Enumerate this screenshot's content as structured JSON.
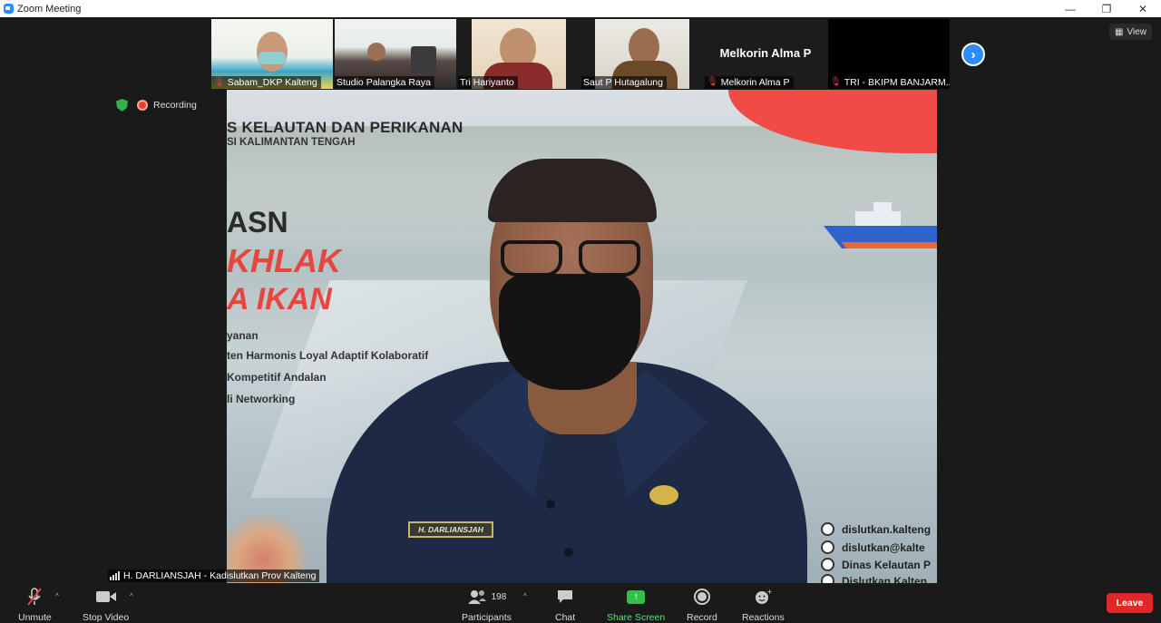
{
  "window": {
    "title": "Zoom Meeting",
    "controls": {
      "minimize": "—",
      "restore": "❐",
      "close": "✕"
    }
  },
  "view_button": {
    "label": "View"
  },
  "recording": {
    "label": "Recording"
  },
  "participants_strip": [
    {
      "name": "Sabam_DKP Kalteng",
      "muted": true
    },
    {
      "name": "Studio Palangka Raya",
      "muted": false
    },
    {
      "name": "Tri Hariyanto",
      "muted": false
    },
    {
      "name": "Saut P Hutagalung",
      "muted": false
    },
    {
      "name": "Melkorin Alma P",
      "muted": true,
      "display_text": "Melkorin Alma P"
    },
    {
      "name": "TRI - BKIPM BANJARM...",
      "muted": true
    }
  ],
  "slide": {
    "heading": "S KELAUTAN DAN PERIKANAN",
    "subheading": "SI KALIMANTAN TENGAH",
    "asn": "ASN",
    "akhlak": "KHLAK",
    "ikan": "A IKAN",
    "lines": [
      {
        "text": "yanan"
      },
      {
        "text": "ten Harmonis Loyal Adaptif Kolaboratif"
      },
      {
        "text": "Kompetitif Andalan"
      },
      {
        "text": "li Networking"
      }
    ],
    "contacts": [
      {
        "text": "dislutkan.kalteng"
      },
      {
        "text": "dislutkan@kalte"
      },
      {
        "text": "Dinas Kelautan P"
      },
      {
        "text": "Dislutkan Kalten"
      }
    ],
    "nametag": "H. DARLIANSJAH"
  },
  "active_speaker": {
    "label": "H. DARLIANSJAH - Kadislutkan Prov Kalteng"
  },
  "toolbar": {
    "unmute": "Unmute",
    "stop_video": "Stop Video",
    "participants": "Participants",
    "participants_count": "198",
    "chat": "Chat",
    "share_screen": "Share Screen",
    "record": "Record",
    "reactions": "Reactions",
    "leave": "Leave"
  },
  "colors": {
    "accent": "#2d8cff",
    "leave": "#e02828",
    "share": "#2fbf4a",
    "recording": "#e8432f"
  }
}
